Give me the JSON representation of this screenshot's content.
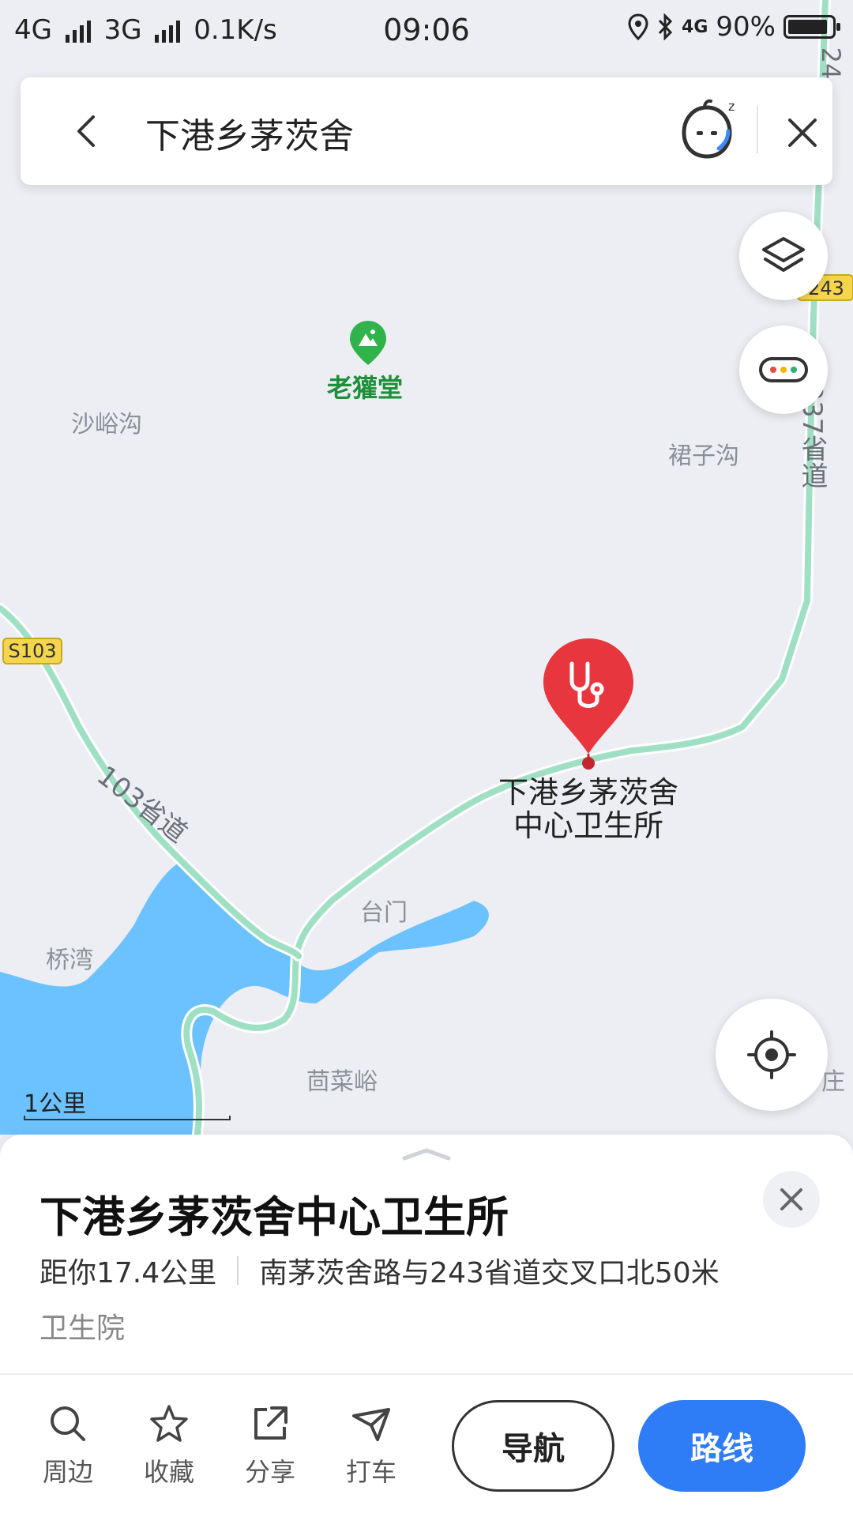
{
  "status_bar": {
    "network_left": "4G",
    "network_mid": "3G",
    "speed": "0.1K/s",
    "time": "09:06",
    "network_right": "4G",
    "battery": "90%",
    "battery_level": 0.9
  },
  "search": {
    "query": "下港乡茅茨舍"
  },
  "map": {
    "water_color": "#6cc2ff",
    "road_color": "#9fe0c5",
    "labels": {
      "shayugou": "沙峪沟",
      "qunzigou": "裙子沟",
      "qiaowan": "桥湾",
      "taimen": "台门",
      "huicaiyu": "茴菜峪",
      "edge_char": "庄"
    },
    "road_labels": {
      "s103": "S103",
      "s243": "243",
      "road103": "103省道",
      "road237": "237省道",
      "road24x": "24"
    },
    "poi": {
      "name": "老獾堂",
      "icon": "mountain-icon"
    },
    "pin": {
      "line1": "下港乡茅茨舍",
      "line2": "中心卫生所",
      "color": "#e8363f",
      "icon": "stethoscope-icon"
    },
    "scale_label": "1公里"
  },
  "sheet": {
    "title": "下港乡茅茨舍中心卫生所",
    "distance": "距你17.4公里",
    "address": "南茅茨舍路与243省道交叉口北50米",
    "category": "卫生院",
    "actions": {
      "nearby": "周边",
      "favorite": "收藏",
      "share": "分享",
      "taxi": "打车"
    },
    "navigate": "导航",
    "route": "路线",
    "accent": "#2e7cf6"
  }
}
